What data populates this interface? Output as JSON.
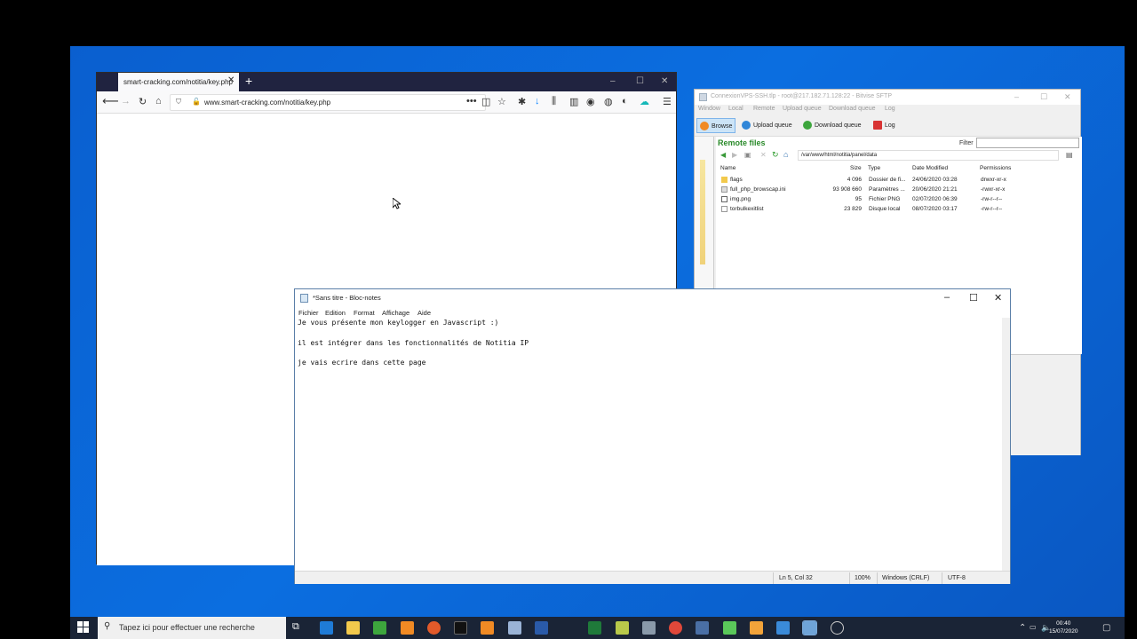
{
  "firefox": {
    "tab_title": "smart-cracking.com/notitia/key.php",
    "new_tab": "+",
    "url": "www.smart-cracking.com/notitia/key.php",
    "minimize": "–",
    "maximize": "☐",
    "close": "✕"
  },
  "bitvise": {
    "title": "ConnexionVPS-SSH.tlp - root@217.182.71.128:22 - Bitvise SFTP",
    "menu": [
      "Window",
      "Local",
      "Remote",
      "Upload queue",
      "Download queue",
      "Log"
    ],
    "toolbar": {
      "browse": "Browse",
      "upload_queue": "Upload queue",
      "download_queue": "Download queue",
      "log": "Log"
    },
    "remote_files_label": "Remote files",
    "filter_label": "Filter",
    "path": "/var/www/html/notitia/panel/data",
    "columns": {
      "name": "Name",
      "size": "Size",
      "type": "Type",
      "date": "Date Modified",
      "perms": "Permissions"
    },
    "files": [
      {
        "name": "flags",
        "size": "4 096",
        "type": "Dossier de fi...",
        "date": "24/06/2020 03:28",
        "perms": "drwxr-xr-x",
        "icon": "folder"
      },
      {
        "name": "full_php_browscap.ini",
        "size": "93 908 660",
        "type": "Paramètres ...",
        "date": "20/06/2020 21:21",
        "perms": "-rwxr-xr-x",
        "icon": "settings-file"
      },
      {
        "name": "img.png",
        "size": "95",
        "type": "Fichier PNG",
        "date": "02/07/2020 06:39",
        "perms": "-rw-r--r--",
        "icon": "image-file"
      },
      {
        "name": "torbulkexitlist",
        "size": "23 829",
        "type": "Disque local",
        "date": "08/07/2020 03:17",
        "perms": "-rw-r--r--",
        "icon": "file"
      }
    ]
  },
  "notepad": {
    "title": "*Sans titre - Bloc-notes",
    "menu": [
      "Fichier",
      "Edition",
      "Format",
      "Affichage",
      "Aide"
    ],
    "lines": [
      "Je vous présente mon keylogger en Javascript :)",
      "",
      "il est intégrer dans les fonctionnalités de Notitia IP",
      "",
      "je vais ecrire dans cette page"
    ],
    "status": {
      "position": "Ln 5, Col 32",
      "zoom": "100%",
      "eol": "Windows (CRLF)",
      "encoding": "UTF-8"
    }
  },
  "taskbar": {
    "search_placeholder": "Tapez ici pour effectuer une recherche",
    "time": "00:40",
    "date": "15/07/2020",
    "colors": {
      "bar": "#1a2436",
      "accent": "#0b6ee0"
    }
  }
}
